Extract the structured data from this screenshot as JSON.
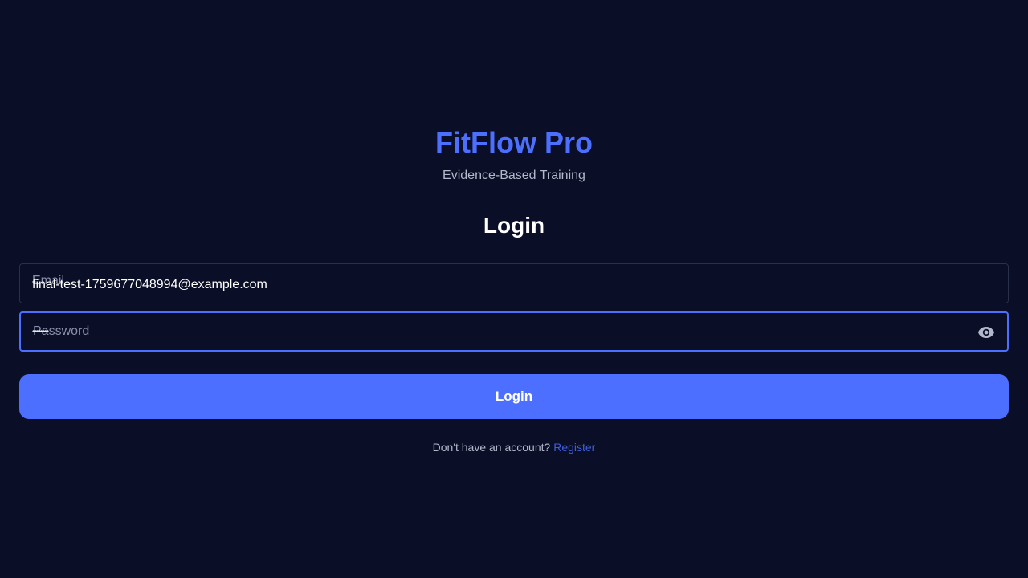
{
  "brand": {
    "title": "FitFlow Pro",
    "subtitle": "Evidence-Based Training"
  },
  "form": {
    "heading": "Login",
    "email": {
      "label": "Email",
      "value": "final-test-1759677048994@example.com"
    },
    "password": {
      "label": "Password",
      "masked_value": "••••••••",
      "toggle_icon": "eye-icon"
    },
    "submit_label": "Login"
  },
  "footer": {
    "prompt": "Don't have an account?",
    "register_label": "Register"
  },
  "colors": {
    "background": "#0a0e27",
    "accent": "#4d6fff",
    "link": "#3f5fd9",
    "muted_text": "#b3b8cc"
  }
}
